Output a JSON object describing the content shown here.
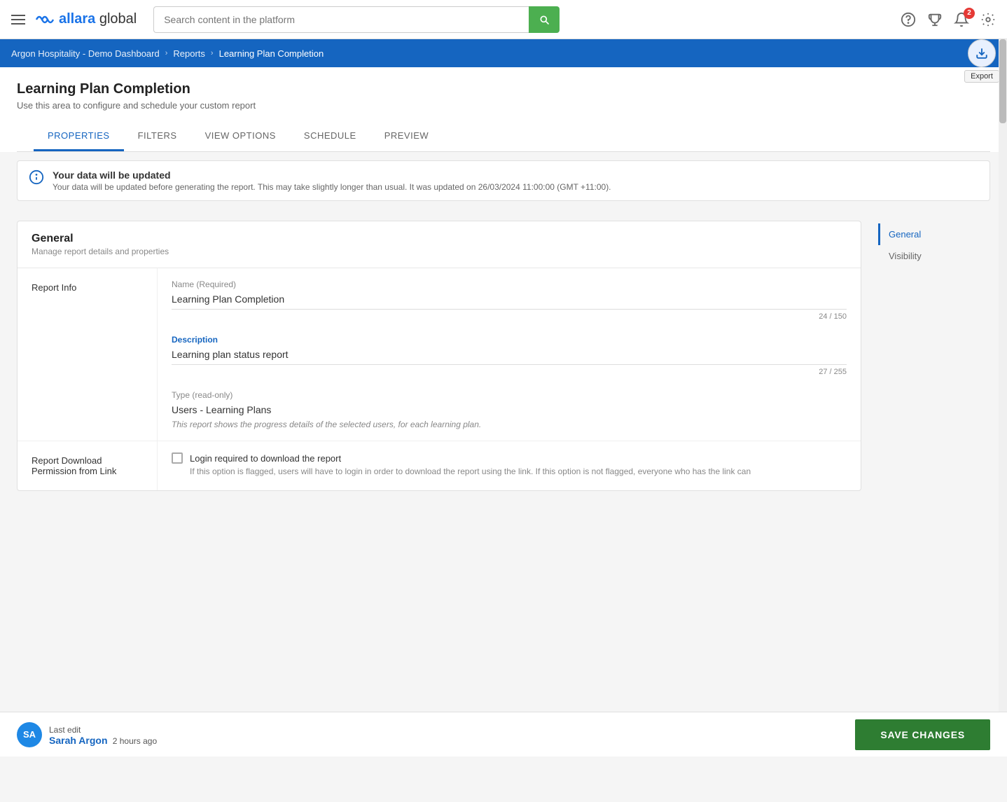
{
  "nav": {
    "search_placeholder": "Search content in the platform",
    "notification_badge": "2"
  },
  "breadcrumb": {
    "home": "Argon Hospitality - Demo Dashboard",
    "reports": "Reports",
    "current": "Learning Plan Completion"
  },
  "export": {
    "label": "Export"
  },
  "page": {
    "title": "Learning Plan Completion",
    "subtitle": "Use this area to configure and schedule your custom report"
  },
  "tabs": [
    {
      "id": "properties",
      "label": "PROPERTIES",
      "active": true
    },
    {
      "id": "filters",
      "label": "FILTERS",
      "active": false
    },
    {
      "id": "view-options",
      "label": "VIEW OPTIONS",
      "active": false
    },
    {
      "id": "schedule",
      "label": "SCHEDULE",
      "active": false
    },
    {
      "id": "preview",
      "label": "PREVIEW",
      "active": false
    }
  ],
  "info_banner": {
    "title": "Your data will be updated",
    "message": "Your data will be updated before generating the report. This may take slightly longer than usual. It was updated on 26/03/2024 11:00:00 (GMT +11:00)."
  },
  "sections": {
    "general": {
      "title": "General",
      "desc": "Manage report details and properties"
    }
  },
  "sidebar_nav": [
    {
      "id": "general",
      "label": "General",
      "active": true
    },
    {
      "id": "visibility",
      "label": "Visibility",
      "active": false
    }
  ],
  "report_info": {
    "label": "Report Info",
    "name_label": "Name",
    "name_required": "(Required)",
    "name_value": "Learning Plan Completion",
    "name_char_count": "24 / 150",
    "desc_label": "Description",
    "desc_value": "Learning plan status report",
    "desc_char_count": "27 / 255",
    "type_label": "Type",
    "type_readonly": "(read-only)",
    "type_value": "Users - Learning Plans",
    "type_desc": "This report shows the progress details of the selected users, for each learning plan."
  },
  "download_permission": {
    "label": "Report Download Permission from Link",
    "checkbox_label": "Login required to download the report",
    "checkbox_desc": "If this option is flagged, users will have to login in order to download the report using the link. If this option is not flagged, everyone who has the link can"
  },
  "bottom_bar": {
    "last_edit_label": "Last edit",
    "user_name": "Sarah Argon",
    "time_ago": "2 hours ago",
    "avatar_initials": "SA",
    "save_label": "SAVE CHANGES"
  }
}
